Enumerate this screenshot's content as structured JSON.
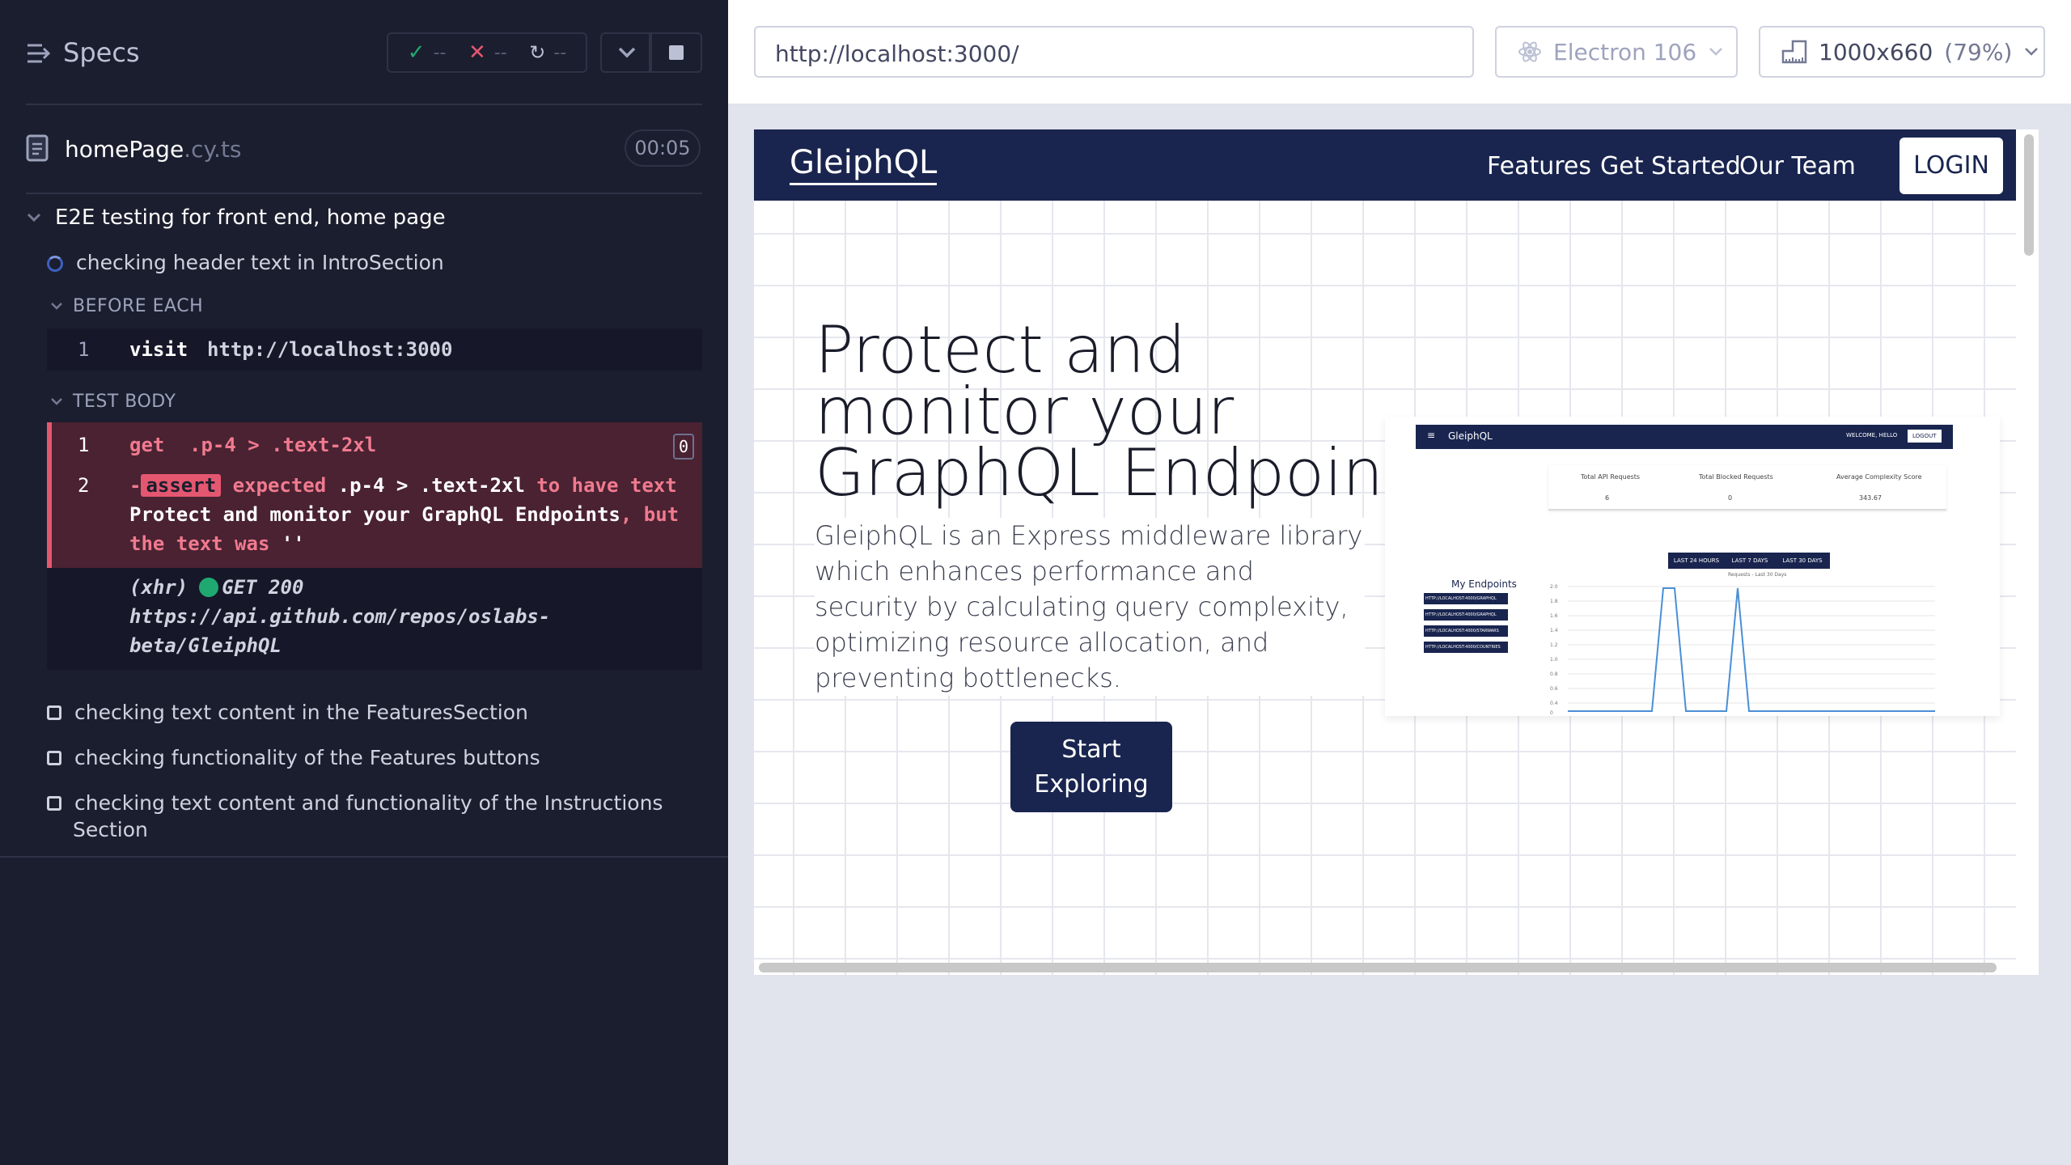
{
  "runner": {
    "specs_label": "Specs",
    "stats": {
      "passed": "--",
      "failed": "--",
      "pending": "--"
    },
    "file": {
      "name": "homePage",
      "ext": ".cy.ts",
      "timer": "00:05"
    },
    "suite_title": "E2E testing for front end, home page",
    "current_test": "checking header text in IntroSection",
    "before_each_label": "BEFORE EACH",
    "before_each": {
      "num": "1",
      "cmd": "visit",
      "arg": "http://localhost:3000"
    },
    "test_body_label": "TEST BODY",
    "body": [
      {
        "num": "1",
        "cmd": "get",
        "arg": ".p-4 > .text-2xl",
        "badge": "0"
      },
      {
        "num": "2",
        "prefix": "-",
        "tag": "assert",
        "t1": "expected",
        "t2": ".p-4 > .text-2xl",
        "t3": "to have",
        "t4": "text",
        "t5": "Protect and monitor your GraphQL",
        "t6": "Endpoints",
        "t7": ", but the text was",
        "t8": "''"
      }
    ],
    "xhr": {
      "label": "(xhr)",
      "status": "GET 200",
      "url1": "https://api.github.com/repos/oslabs-",
      "url2": "beta/GleiphQL"
    },
    "pending_tests": [
      "checking text content in the FeaturesSection",
      "checking functionality of the Features buttons",
      "checking text content and functionality of the Instructions",
      "Section"
    ]
  },
  "browser": {
    "url": "http://localhost:3000/",
    "name": "Electron 106",
    "viewport": "1000x660",
    "zoom": "(79%)"
  },
  "app": {
    "brand": "GleiphQL",
    "nav": [
      "Features",
      "Get Started",
      "Our Team"
    ],
    "login": "LOGIN",
    "hero_title": [
      "Protect and",
      "monitor your",
      "GraphQL Endpoints"
    ],
    "hero_desc": "GleiphQL is an Express middleware library which enhances performance and security by calculating query complexity, optimizing resource allocation, and preventing bottlenecks.",
    "cta": [
      "Start",
      "Exploring"
    ],
    "preview": {
      "brand": "GleiphQL",
      "welcome": "WELCOME, HELLO",
      "logout": "LOGOUT",
      "stats_headers": [
        "Total API Requests",
        "Total Blocked Requests",
        "Average Complexity Score"
      ],
      "stats_values": [
        "6",
        "0",
        "343.67"
      ],
      "range_buttons": [
        "LAST 24 HOURS",
        "LAST 7 DAYS",
        "LAST 30 DAYS"
      ],
      "chart_title": "Requests - Last 30 Days",
      "endpoints_title": "My Endpoints",
      "endpoints": [
        "HTTP://LOCALHOST:4000/GRAPHQL",
        "HTTP://LOCALHOST:4000/GRAPHQL",
        "HTTP://LOCALHOST:4000/STARWARS",
        "HTTP://LOCALHOST:4000/COUNTRIES"
      ],
      "y_ticks": [
        "2.0",
        "1.8",
        "1.6",
        "1.4",
        "1.2",
        "1.0",
        "0.8",
        "0.6",
        "0.4",
        "0.2",
        "0"
      ]
    }
  }
}
